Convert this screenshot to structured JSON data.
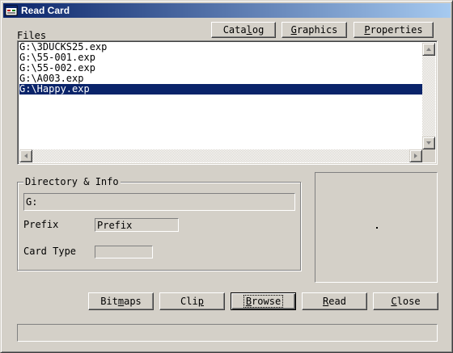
{
  "window": {
    "title": "Read Card"
  },
  "toolbar": {
    "catalog": {
      "pre": "Cata",
      "u": "l",
      "post": "og"
    },
    "graphics": {
      "pre": "",
      "u": "G",
      "post": "raphics"
    },
    "properties": {
      "pre": "",
      "u": "P",
      "post": "roperties"
    }
  },
  "files": {
    "label": "Files",
    "items": [
      "G:\\3DUCKS25.exp",
      "G:\\55-001.exp",
      "G:\\55-002.exp",
      "G:\\A003.exp",
      "G:\\Happy.exp"
    ],
    "selected_index": 4
  },
  "info": {
    "group_label": "Directory & Info",
    "directory": "G:",
    "prefix_label": "Prefix",
    "prefix_value": "Prefix",
    "card_type_label": "Card Type",
    "card_type_value": ""
  },
  "preview": {
    "content": "."
  },
  "actions": {
    "bitmaps": {
      "pre": "Bit",
      "u": "m",
      "post": "aps"
    },
    "clip": {
      "pre": "Cli",
      "u": "p",
      "post": ""
    },
    "browse": {
      "pre": "",
      "u": "B",
      "post": "rowse"
    },
    "read": {
      "pre": "",
      "u": "R",
      "post": "ead"
    },
    "close": {
      "pre": "",
      "u": "C",
      "post": "lose"
    }
  },
  "status": {
    "text": ""
  },
  "colors": {
    "title_start": "#0a246a",
    "title_end": "#a6caf0",
    "selection": "#0a246a",
    "face": "#d4d0c8"
  }
}
